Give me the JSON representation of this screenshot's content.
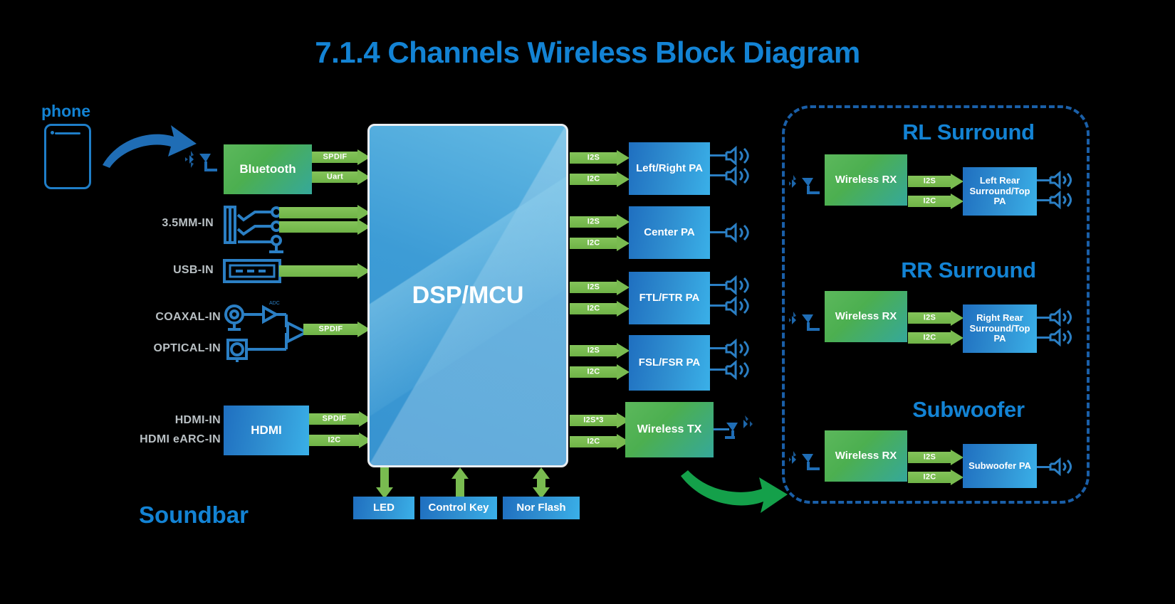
{
  "title": "7.1.4 Channels Wireless Block Diagram",
  "colors": {
    "accent_blue": "#1383d4",
    "arrow_green": "#79bb50",
    "block_green_start": "#5cb85c",
    "block_blue": "#2f8ed0",
    "dashed_border": "#1a5fa8",
    "label_grey": "#b9c0c4",
    "background": "#000000",
    "curved_arrow_blue": "#1f6db5",
    "curved_arrow_green": "#14a04a"
  },
  "soundbar": {
    "zone_label": "Soundbar",
    "phone": {
      "label": "phone"
    },
    "core": {
      "label": "DSP/MCU"
    },
    "input_blocks": [
      {
        "label": "Bluetooth",
        "kind": "green"
      },
      {
        "label": "HDMI",
        "kind": "blue"
      }
    ],
    "input_labels": [
      {
        "label": "3.5MM-IN"
      },
      {
        "label": "USB-IN"
      },
      {
        "label": "COAXAL-IN"
      },
      {
        "label": "OPTICAL-IN"
      },
      {
        "label": "HDMI-IN"
      },
      {
        "label": "HDMI eARC-IN"
      }
    ],
    "bluetooth_outputs": [
      {
        "label": "SPDIF"
      },
      {
        "label": "Uart"
      }
    ],
    "analog_outputs": [
      {
        "label": ""
      },
      {
        "label": ""
      },
      {
        "label": ""
      }
    ],
    "spdif_mixer_output": {
      "label": "SPDIF"
    },
    "hdmi_outputs": [
      {
        "label": "SPDIF"
      },
      {
        "label": "I2C"
      }
    ],
    "amp_blocks": [
      {
        "label": "Left/Right PA",
        "buses": [
          "I2S",
          "I2C"
        ],
        "speakers": 2
      },
      {
        "label": "Center PA",
        "buses": [
          "I2S",
          "I2C"
        ],
        "speakers": 1
      },
      {
        "label": "FTL/FTR PA",
        "buses": [
          "I2S",
          "I2C"
        ],
        "speakers": 2
      },
      {
        "label": "FSL/FSR PA",
        "buses": [
          "I2S",
          "I2C"
        ],
        "speakers": 2
      }
    ],
    "wireless_tx": {
      "label": "Wireless TX",
      "buses": [
        "I2S*3",
        "I2C"
      ]
    },
    "peripherals": [
      {
        "label": "LED",
        "direction": "down"
      },
      {
        "label": "Control Key",
        "direction": "up"
      },
      {
        "label": "Nor Flash",
        "direction": "both"
      }
    ]
  },
  "wireless_zones": [
    {
      "title": "RL Surround",
      "rx": {
        "label": "Wireless RX"
      },
      "buses": [
        "I2S",
        "I2C"
      ],
      "pa": {
        "label": "Left Rear Surround/Top PA",
        "speakers": 2
      }
    },
    {
      "title": "RR Surround",
      "rx": {
        "label": "Wireless RX"
      },
      "buses": [
        "I2S",
        "I2C"
      ],
      "pa": {
        "label": "Right Rear Surround/Top PA",
        "speakers": 2
      }
    },
    {
      "title": "Subwoofer",
      "rx": {
        "label": "Wireless RX"
      },
      "buses": [
        "I2S",
        "I2C"
      ],
      "pa": {
        "label": "Subwoofer PA",
        "speakers": 1
      }
    }
  ],
  "icons": {
    "antenna": "antenna-icon",
    "speaker": "speaker-icon",
    "phone": "phone-icon",
    "usb_port": "usb-port-icon",
    "jack_switch": "jack-switch-icon",
    "coax_connector": "coax-connector-icon",
    "optical_connector": "optical-connector-icon",
    "amplifier_triangle": "amplifier-icon",
    "curved_arrow_blue": "curved-arrow-icon",
    "curved_arrow_green": "curved-arrow-icon"
  }
}
